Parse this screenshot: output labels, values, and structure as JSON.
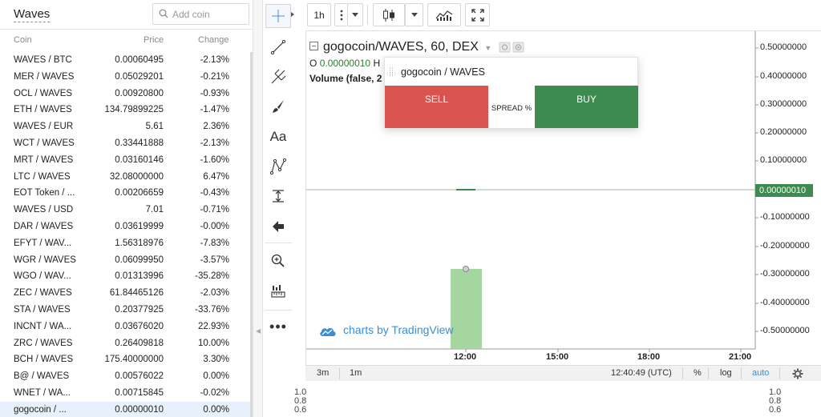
{
  "market": {
    "title": "Waves",
    "search_placeholder": "Add coin",
    "columns": {
      "coin": "Coin",
      "price": "Price",
      "change": "Change"
    },
    "rows": [
      {
        "pair": "WAVES / BTC",
        "price": "0.00060495",
        "change": "-2.13%"
      },
      {
        "pair": "MER / WAVES",
        "price": "0.05029201",
        "change": "-0.21%"
      },
      {
        "pair": "OCL / WAVES",
        "price": "0.00920800",
        "change": "-0.93%"
      },
      {
        "pair": "ETH / WAVES",
        "price": "134.79899225",
        "change": "-1.47%"
      },
      {
        "pair": "WAVES / EUR",
        "price": "5.61",
        "change": "2.36%"
      },
      {
        "pair": "WCT / WAVES",
        "price": "0.33441888",
        "change": "-2.13%"
      },
      {
        "pair": "MRT / WAVES",
        "price": "0.03160146",
        "change": "-1.60%"
      },
      {
        "pair": "LTC / WAVES",
        "price": "32.08000000",
        "change": "6.47%"
      },
      {
        "pair": "EOT Token / ...",
        "price": "0.00206659",
        "change": "-0.43%"
      },
      {
        "pair": "WAVES / USD",
        "price": "7.01",
        "change": "-0.71%"
      },
      {
        "pair": "DAR / WAVES",
        "price": "0.03619999",
        "change": "-0.00%"
      },
      {
        "pair": "EFYT / WAV...",
        "price": "1.56318976",
        "change": "-7.83%"
      },
      {
        "pair": "WGR / WAVES",
        "price": "0.06099950",
        "change": "-3.57%"
      },
      {
        "pair": "WGO / WAV...",
        "price": "0.01313996",
        "change": "-35.28%"
      },
      {
        "pair": "ZEC / WAVES",
        "price": "61.84465126",
        "change": "-2.03%"
      },
      {
        "pair": "STA / WAVES",
        "price": "0.20377925",
        "change": "-33.76%"
      },
      {
        "pair": "INCNT / WA...",
        "price": "0.03676020",
        "change": "22.93%"
      },
      {
        "pair": "ZRC / WAVES",
        "price": "0.26409818",
        "change": "10.00%"
      },
      {
        "pair": "BCH / WAVES",
        "price": "175.40000000",
        "change": "3.30%"
      },
      {
        "pair": "B@ / WAVES",
        "price": "0.00576022",
        "change": "0.00%"
      },
      {
        "pair": "WNET / WA...",
        "price": "0.00715845",
        "change": "-0.02%"
      },
      {
        "pair": "gogocoin / ...",
        "price": "0.00000010",
        "change": "0.00%"
      }
    ],
    "selected_index": 21
  },
  "toolbar": {
    "interval": "1h",
    "icons": [
      "candles-icon",
      "indicators-icon",
      "fullscreen-icon"
    ]
  },
  "drawing_tools": [
    "crosshair-icon",
    "trendline-icon",
    "pitchfork-icon",
    "brush-icon",
    "text-tool-icon",
    "pattern-icon",
    "measure-icon",
    "arrow-left-icon",
    "zoom-in-icon",
    "ruler-icon",
    "more-icon"
  ],
  "chart": {
    "symbol_title": "gogocoin/WAVES, 60, DEX",
    "ohlc_prefix": "O",
    "ohlc_open": "0.00000010",
    "ohlc_high_label": "H",
    "volume_label": "Volume (false, 2",
    "current_price": "0.00000010",
    "y_ticks": [
      "0.50000000",
      "0.40000000",
      "0.30000000",
      "0.20000000",
      "0.10000000",
      "-0.10000000",
      "-0.20000000",
      "-0.30000000",
      "-0.40000000",
      "-0.50000000"
    ],
    "x_ticks": [
      "12:00",
      "15:00",
      "18:00",
      "21:00"
    ],
    "watermark": "charts by TradingView",
    "colors": {
      "up": "#3d8b4f",
      "volume": "#a5d6a0",
      "sell": "#d9534f"
    }
  },
  "trade": {
    "pair": "gogocoin / WAVES",
    "sell": "SELL",
    "spread": "SPREAD %",
    "buy": "BUY"
  },
  "bottom": {
    "range_3m": "3m",
    "range_1m": "1m",
    "time": "12:40:49 (UTC)",
    "percent": "%",
    "log": "log",
    "auto": "auto"
  },
  "extra_axis": {
    "left": [
      "1.0",
      "0.8",
      "0.6"
    ],
    "right": [
      "1.0",
      "0.8",
      "0.6"
    ]
  }
}
